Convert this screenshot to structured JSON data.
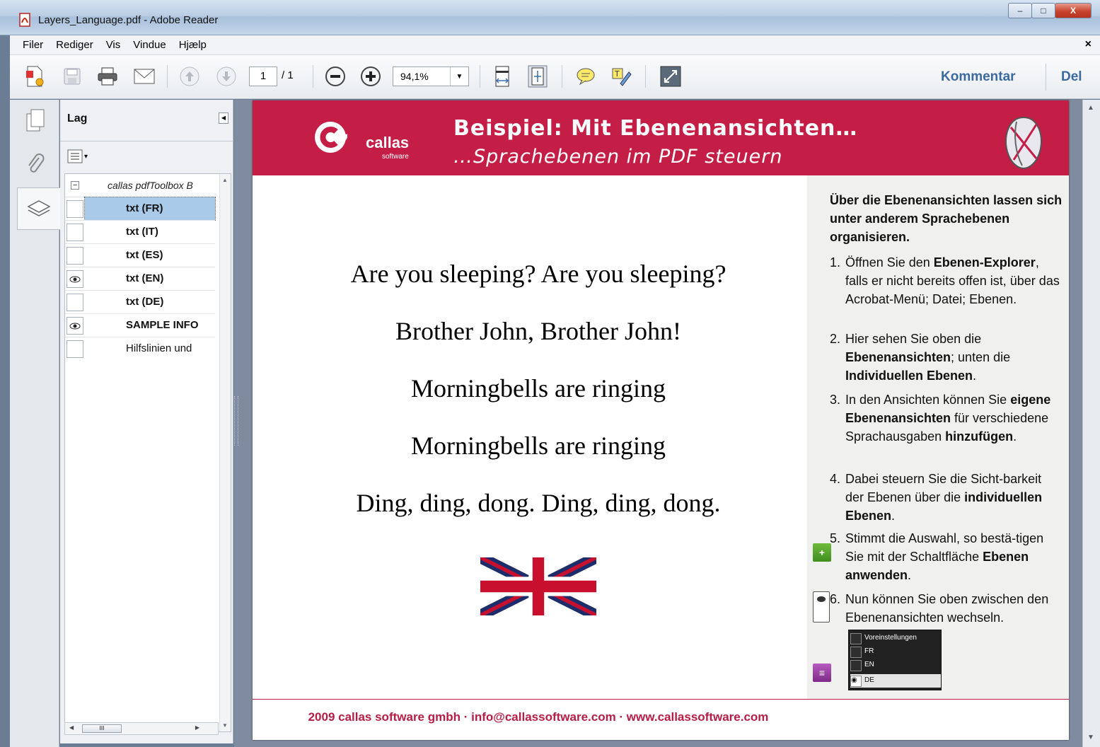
{
  "window": {
    "title": "Layers_Language.pdf - Adobe Reader",
    "min": "‒",
    "max": "□",
    "close": "X"
  },
  "menu": {
    "items": [
      "Filer",
      "Rediger",
      "Vis",
      "Vindue",
      "Hjælp"
    ],
    "close": "×"
  },
  "toolbar": {
    "page_current": "1",
    "page_total": "/ 1",
    "zoom": "94,1%",
    "comment_label": "Kommentar",
    "share_label": "Del"
  },
  "layers_panel": {
    "title": "Lag",
    "root_label": "callas pdfToolbox B",
    "layers": [
      {
        "label": "txt (FR)",
        "visible": false,
        "selected": true,
        "bold": true
      },
      {
        "label": "txt (IT)",
        "visible": false,
        "selected": false,
        "bold": true
      },
      {
        "label": "txt (ES)",
        "visible": false,
        "selected": false,
        "bold": true
      },
      {
        "label": "txt (EN)",
        "visible": true,
        "selected": false,
        "bold": true
      },
      {
        "label": "txt (DE)",
        "visible": false,
        "selected": false,
        "bold": true
      },
      {
        "label": "SAMPLE INFO",
        "visible": true,
        "selected": false,
        "bold": true
      },
      {
        "label": "Hilfslinien und",
        "visible": false,
        "selected": false,
        "bold": false
      }
    ],
    "hscroll_thumb": "III"
  },
  "document": {
    "logo_text": "callas",
    "logo_sub": "software",
    "banner_title": "Beispiel: Mit Ebenenansichten…",
    "banner_subtitle": "…Sprachebenen im PDF steuern",
    "song_lines": [
      "Are you sleeping? Are you sleeping?",
      "Brother John, Brother John!",
      "Morningbells are ringing",
      "Morningbells are ringing",
      "Ding, ding, dong. Ding, ding, dong."
    ],
    "intro": "Über die Ebenenansichten lassen sich unter anderem Sprachebenen organisieren.",
    "steps": [
      {
        "num": "1.",
        "parts": [
          "Öffnen Sie den ",
          "Ebenen-Explorer",
          ", falls er nicht bereits offen ist, über das Acrobat-Menü; Datei; Ebenen."
        ]
      },
      {
        "num": "2.",
        "parts": [
          "Hier sehen Sie oben die ",
          "Ebenenansichten",
          "; unten die ",
          "Individuellen Ebenen",
          "."
        ]
      },
      {
        "num": "3.",
        "parts": [
          "In den Ansichten können Sie ",
          "eigene Ebenenansichten",
          " für verschiedene Sprachausgaben ",
          "hinzufügen",
          "."
        ]
      },
      {
        "num": "4.",
        "parts": [
          "Dabei steuern Sie die Sicht-barkeit der Ebenen über die ",
          "individuellen Ebenen",
          "."
        ]
      },
      {
        "num": "5.",
        "parts": [
          "Stimmt die Auswahl, so bestä-tigen Sie mit der Schaltfläche ",
          "Ebenen anwenden",
          "."
        ]
      },
      {
        "num": "6.",
        "parts": [
          "Nun können Sie oben zwischen den Ebenenansichten wechseln."
        ]
      }
    ],
    "mini_panel": [
      "Voreinstellungen",
      "FR",
      "EN",
      "DE"
    ],
    "footer": "2009 callas software gmbh · info@callassoftware.com · www.callassoftware.com",
    "colors": {
      "brand": "#c41e47"
    }
  }
}
